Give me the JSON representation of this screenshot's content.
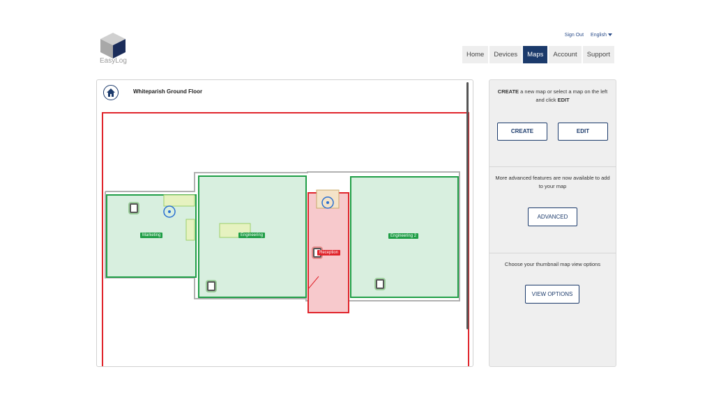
{
  "brand": {
    "name": "EasyLog"
  },
  "top_links": {
    "sign_out": "Sign Out",
    "language": "English"
  },
  "nav": {
    "tabs": [
      "Home",
      "Devices",
      "Maps",
      "Account",
      "Support"
    ],
    "active": "Maps"
  },
  "map": {
    "title": "Whiteparish Ground Floor",
    "rooms": [
      {
        "label": "Marketing",
        "status": "ok"
      },
      {
        "label": "Engineering",
        "status": "ok"
      },
      {
        "label": "Reception",
        "status": "alarm"
      },
      {
        "label": "Engineering 2",
        "status": "ok"
      }
    ],
    "colors": {
      "ok": "#1f9e46",
      "alarm": "#e0242b",
      "ok_fill": "#d8efdf",
      "alarm_fill": "#f7c9cc"
    }
  },
  "side_panel": {
    "create": {
      "text_parts": [
        "CREATE",
        " a new map or select a map on the left and click ",
        "EDIT"
      ],
      "create_label": "CREATE",
      "edit_label": "EDIT"
    },
    "advanced": {
      "text": "More advanced features are now available to add to your map",
      "label": "ADVANCED"
    },
    "view": {
      "text": "Choose your thumbnail map view options",
      "label": "VIEW OPTIONS"
    }
  }
}
